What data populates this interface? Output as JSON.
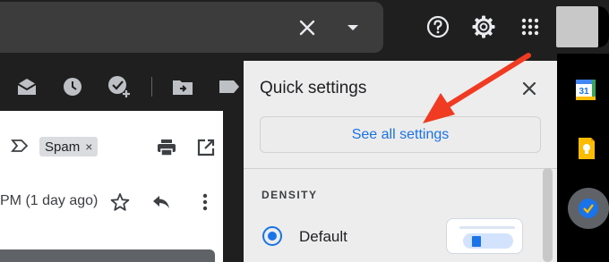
{
  "search": {
    "clear_icon": "close-icon",
    "options_icon": "caret-down-icon"
  },
  "header": {
    "icons": [
      "help-icon",
      "settings-gear-icon",
      "apps-grid-icon"
    ],
    "avatar": "avatar"
  },
  "toolbar": {
    "icons": [
      "mark-as-unread-icon",
      "snooze-icon",
      "add-to-tasks-icon",
      "move-to-icon",
      "label-icon"
    ]
  },
  "email": {
    "label_chip": "Spam",
    "label_remove": "×",
    "time": "PM (1 day ago)"
  },
  "quick_settings": {
    "title": "Quick settings",
    "see_all": "See all settings",
    "section_density": "DENSITY",
    "density_default": "Default"
  },
  "apps_rail": {
    "calendar_day": "31",
    "items": [
      "calendar-icon",
      "keep-icon",
      "tasks-icon"
    ]
  },
  "colors": {
    "accent": "#1a73e8",
    "arrow": "#f03a22",
    "panel": "#ededed",
    "dark_bg": "#1f1f1f"
  }
}
